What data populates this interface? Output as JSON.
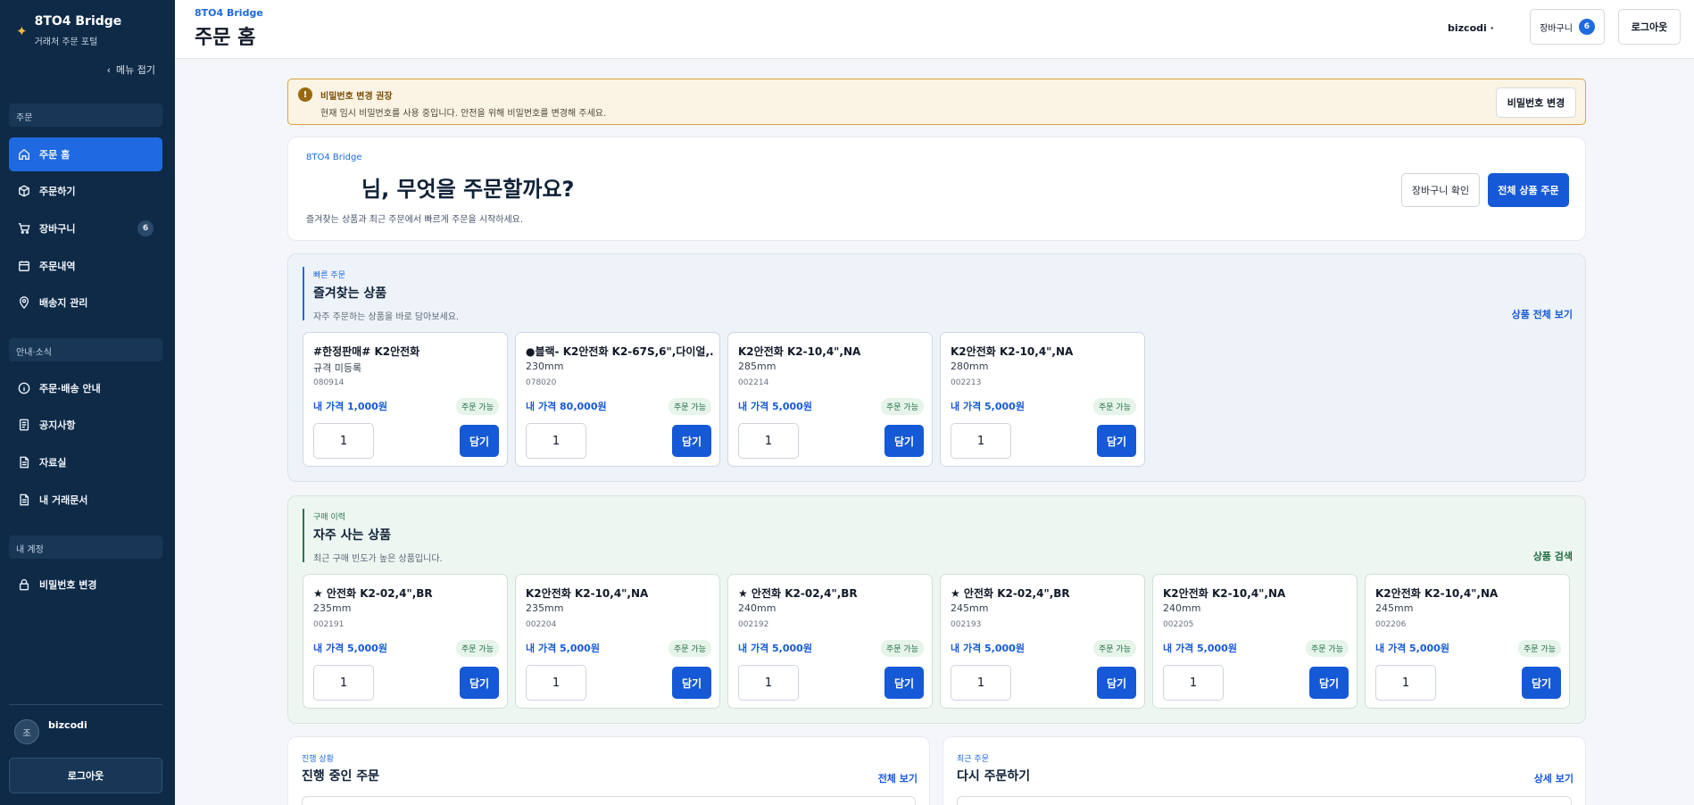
{
  "sidebar": {
    "brand_title": "8TO4 Bridge",
    "brand_sub": "거래처 주문 포털",
    "collapse_label": "메뉴 접기",
    "sections": {
      "order": "주문",
      "info": "안내·소식",
      "account": "내 계정"
    },
    "items": {
      "home": "주문 홈",
      "order": "주문하기",
      "cart": "장바구니",
      "cart_badge": "6",
      "history": "주문내역",
      "shipping": "배송지 관리",
      "guide": "주문·배송 안내",
      "notice": "공지사항",
      "library": "자료실",
      "docs": "내 거래문서",
      "password": "비밀번호 변경"
    },
    "user_avatar": "조",
    "user_name": "bizcodi",
    "logout": "로그아웃"
  },
  "header": {
    "brand": "8TO4 Bridge",
    "title": "주문 홈",
    "user": "bizcodi ·",
    "cart_label": "장바구니",
    "cart_count": "6",
    "logout": "로그아웃"
  },
  "alert": {
    "icon": "!",
    "title": "비밀번호 변경 권장",
    "message": "현재 임시 비밀번호를 사용 중입니다. 안전을 위해 비밀번호를 변경해 주세요.",
    "button": "비밀번호 변경"
  },
  "hero": {
    "brand": "8TO4 Bridge",
    "title": "님, 무엇을 주문할까요?",
    "desc": "즐겨찾는 상품과 최근 주문에서 빠르게 주문을 시작하세요.",
    "cart_button": "장바구니 확인",
    "all_button": "전체 상품 주문"
  },
  "favorites": {
    "kicker": "빠른 주문",
    "title": "즐겨찾는 상품",
    "sub": "자주 주문하는 상품을 바로 담아보세요.",
    "link": "상품 전체 보기",
    "items": [
      {
        "name": "#한정판매# K2안전화",
        "spec": "규격 미등록",
        "code": "080914",
        "price": "내 가격 1,000원",
        "status": "주문 가능",
        "qty": "1",
        "add": "담기"
      },
      {
        "name": "●블랙- K2안전화 K2-67S,6\",다이얼,...",
        "spec": "230mm",
        "code": "078020",
        "price": "내 가격 80,000원",
        "status": "주문 가능",
        "qty": "1",
        "add": "담기"
      },
      {
        "name": "K2안전화 K2-10,4\",NA",
        "spec": "285mm",
        "code": "002214",
        "price": "내 가격 5,000원",
        "status": "주문 가능",
        "qty": "1",
        "add": "담기"
      },
      {
        "name": "K2안전화 K2-10,4\",NA",
        "spec": "280mm",
        "code": "002213",
        "price": "내 가격 5,000원",
        "status": "주문 가능",
        "qty": "1",
        "add": "담기"
      }
    ]
  },
  "frequent": {
    "kicker": "구매 이력",
    "title": "자주 사는 상품",
    "sub": "최근 구매 빈도가 높은 상품입니다.",
    "link": "상품 검색",
    "items": [
      {
        "name": "★ 안전화 K2-02,4\",BR",
        "spec": "235mm",
        "code": "002191",
        "price": "내 가격 5,000원",
        "status": "주문 가능",
        "qty": "1",
        "add": "담기"
      },
      {
        "name": "K2안전화 K2-10,4\",NA",
        "spec": "235mm",
        "code": "002204",
        "price": "내 가격 5,000원",
        "status": "주문 가능",
        "qty": "1",
        "add": "담기"
      },
      {
        "name": "★ 안전화 K2-02,4\",BR",
        "spec": "240mm",
        "code": "002192",
        "price": "내 가격 5,000원",
        "status": "주문 가능",
        "qty": "1",
        "add": "담기"
      },
      {
        "name": "★ 안전화 K2-02,4\",BR",
        "spec": "245mm",
        "code": "002193",
        "price": "내 가격 5,000원",
        "status": "주문 가능",
        "qty": "1",
        "add": "담기"
      },
      {
        "name": "K2안전화 K2-10,4\",NA",
        "spec": "240mm",
        "code": "002205",
        "price": "내 가격 5,000원",
        "status": "주문 가능",
        "qty": "1",
        "add": "담기"
      },
      {
        "name": "K2안전화 K2-10,4\",NA",
        "spec": "245mm",
        "code": "002206",
        "price": "내 가격 5,000원",
        "status": "주문 가능",
        "qty": "1",
        "add": "담기"
      }
    ]
  },
  "in_progress": {
    "kicker": "진행 상황",
    "title": "진행 중인 주문",
    "link": "전체 보기"
  },
  "reorder": {
    "kicker": "최근 주문",
    "title": "다시 주문하기",
    "link": "상세 보기"
  }
}
